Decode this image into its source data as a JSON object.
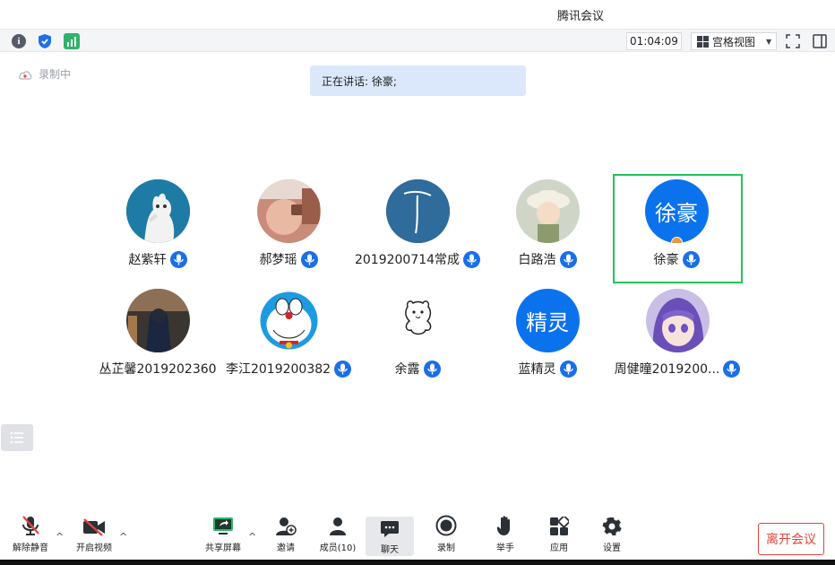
{
  "window": {
    "title": "腾讯会议"
  },
  "toolbar": {
    "timer": "01:04:09",
    "view_mode": "宫格视图",
    "icons": [
      "info-icon",
      "shield-icon",
      "signal-icon",
      "fullscreen-icon",
      "side-panel-icon"
    ]
  },
  "recording": {
    "status": "录制中"
  },
  "speaking": {
    "text": "正在讲话: 徐豪;"
  },
  "participants": [
    {
      "name": "赵紫轩",
      "avatar": "cat-photo",
      "mic": "on"
    },
    {
      "name": "郝梦瑶",
      "avatar": "child-photo",
      "mic": "on"
    },
    {
      "name": "2019200714常成",
      "avatar": "ink-figure",
      "mic": "on"
    },
    {
      "name": "白路浩",
      "avatar": "cartoon-hat",
      "mic": "on"
    },
    {
      "name": "徐豪",
      "avatar_text": "徐豪",
      "mic": "on",
      "host": true,
      "active_speaker": true
    },
    {
      "name": "丛芷馨2019202360",
      "avatar": "armor-figure",
      "mic": "none"
    },
    {
      "name": "李江2019200382",
      "avatar": "doraemon",
      "mic": "on"
    },
    {
      "name": "余露",
      "avatar": "bear-doodle",
      "mic": "on"
    },
    {
      "name": "蓝精灵",
      "avatar_text": "精灵",
      "mic": "on"
    },
    {
      "name": "周健曈2019200...",
      "avatar": "anime-girl",
      "mic": "on"
    }
  ],
  "controls": {
    "unmute": "解除静音",
    "start_video": "开启视频",
    "share_screen": "共享屏幕",
    "invite": "邀请",
    "members": "成员(10)",
    "chat": "聊天",
    "record": "录制",
    "raise_hand": "举手",
    "apps": "应用",
    "settings": "设置",
    "leave": "离开会议"
  },
  "colors": {
    "accent": "#1a6fe8",
    "active_border": "#22c35a",
    "leave": "#e0443d",
    "speaking_bg": "#dbe8fb"
  }
}
